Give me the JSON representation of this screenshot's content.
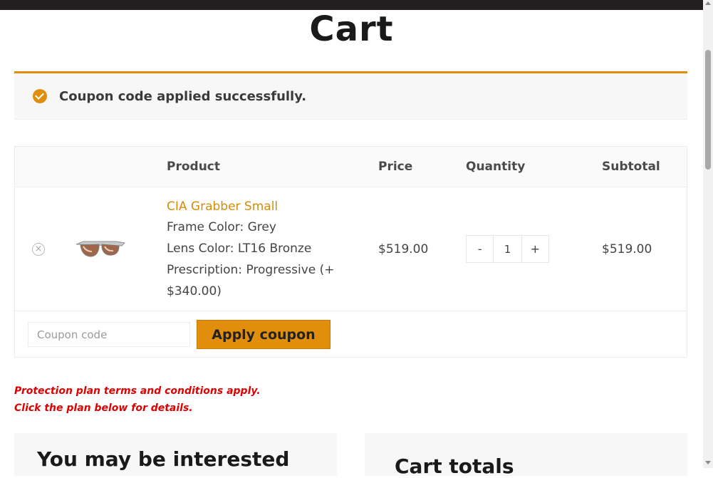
{
  "page": {
    "title": "Cart",
    "colors": {
      "accent": "#e08e0b",
      "link": "#d68c0b",
      "warning": "#e00000"
    }
  },
  "notice": {
    "icon": "check-circle-icon",
    "message": "Coupon code applied successfully."
  },
  "cart": {
    "headers": {
      "product": "Product",
      "price": "Price",
      "quantity": "Quantity",
      "subtotal": "Subtotal"
    },
    "item": {
      "remove_icon": "remove-circle-icon",
      "name": "CIA Grabber Small",
      "frame_label": "Frame Color:",
      "frame_value": "Grey",
      "lens_label": "Lens Color:",
      "lens_value": "LT16 Bronze",
      "rx_label": "Prescription:",
      "rx_value_line1": "Progressive (+",
      "rx_value_line2": "$340.00)",
      "price": "$519.00",
      "qty_minus": "-",
      "qty_value": "1",
      "qty_plus": "+",
      "subtotal": "$519.00"
    },
    "coupon": {
      "placeholder": "Coupon code",
      "apply_label": "Apply coupon"
    }
  },
  "protection": {
    "line1": "Protection plan terms and conditions apply.",
    "line2": "Click the plan below for details."
  },
  "panels": {
    "interested_title": "You may be interested",
    "totals_title": "Cart totals"
  }
}
